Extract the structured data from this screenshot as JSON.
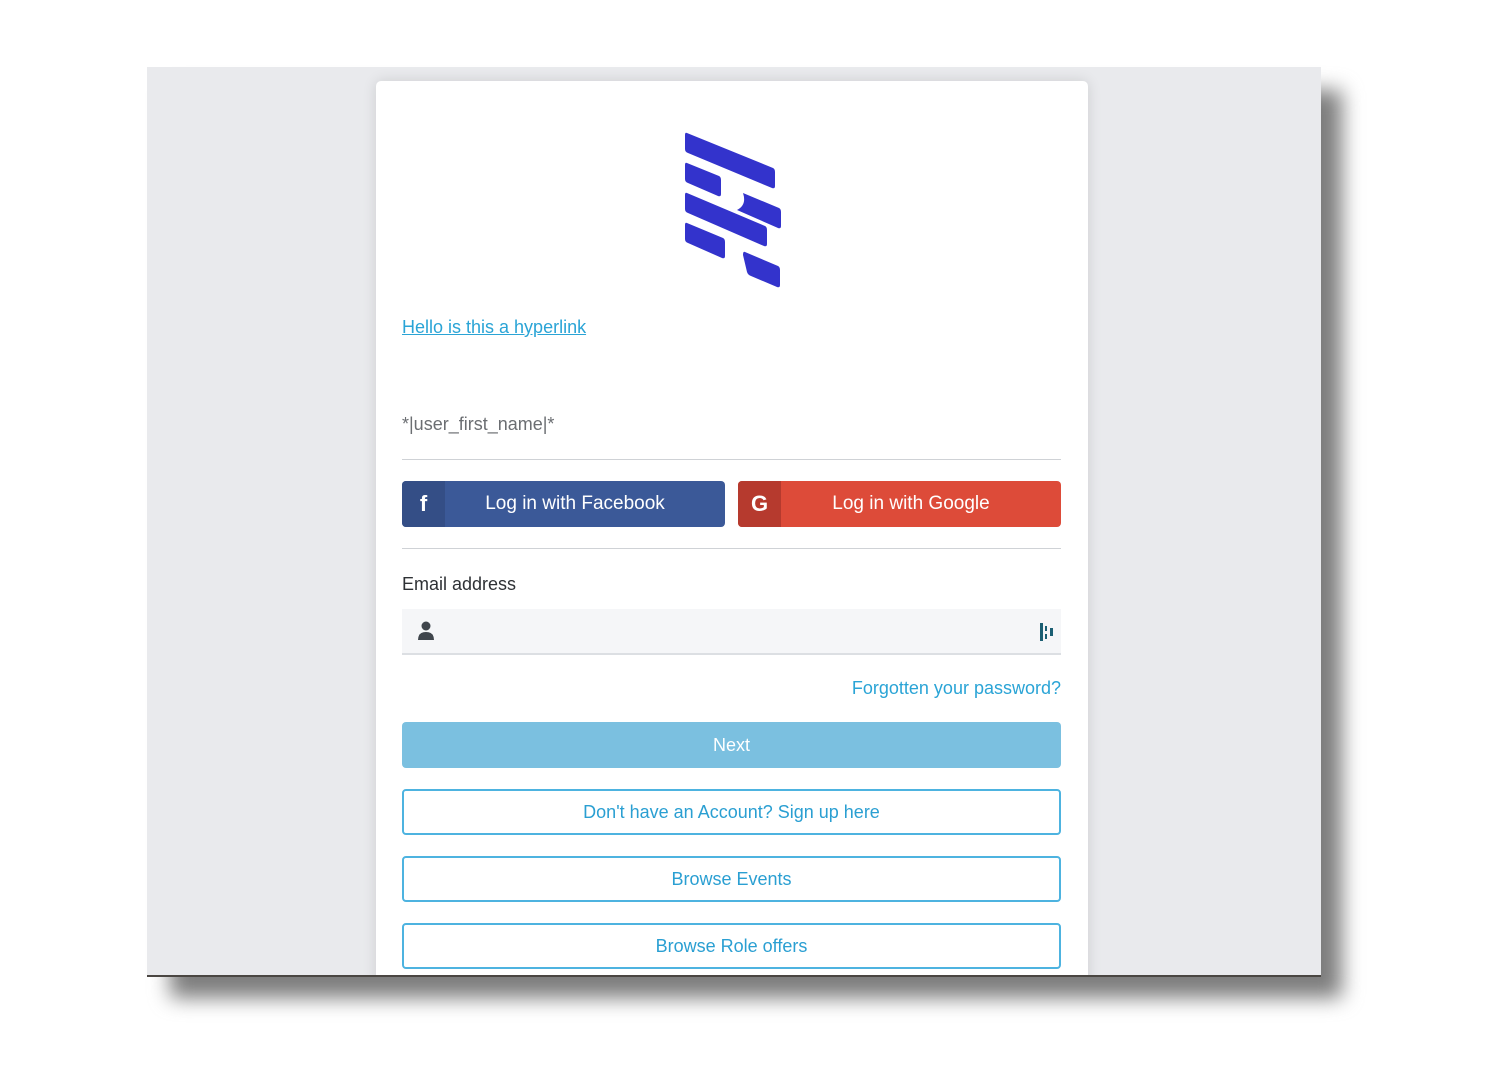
{
  "logo": {
    "name": "brand-logo",
    "color": "#3333cc"
  },
  "hyperlink": "Hello is this a hyperlink",
  "merge_tag": "*|user_first_name|*",
  "social": {
    "facebook": {
      "icon": "f",
      "label": "Log in with Facebook",
      "color": "#3b5998"
    },
    "google": {
      "icon": "G",
      "label": "Log in with Google",
      "color": "#dd4b39"
    }
  },
  "email": {
    "label": "Email address",
    "value": "",
    "placeholder": ""
  },
  "forgot_password": "Forgotten your password?",
  "buttons": {
    "next": "Next",
    "signup": "Don't have an Account? Sign up here",
    "browse_events": "Browse Events",
    "browse_roles": "Browse Role offers"
  },
  "colors": {
    "accent": "#2aa4d6",
    "next_disabled": "#7bc0e0",
    "background": "#e9eaed"
  }
}
